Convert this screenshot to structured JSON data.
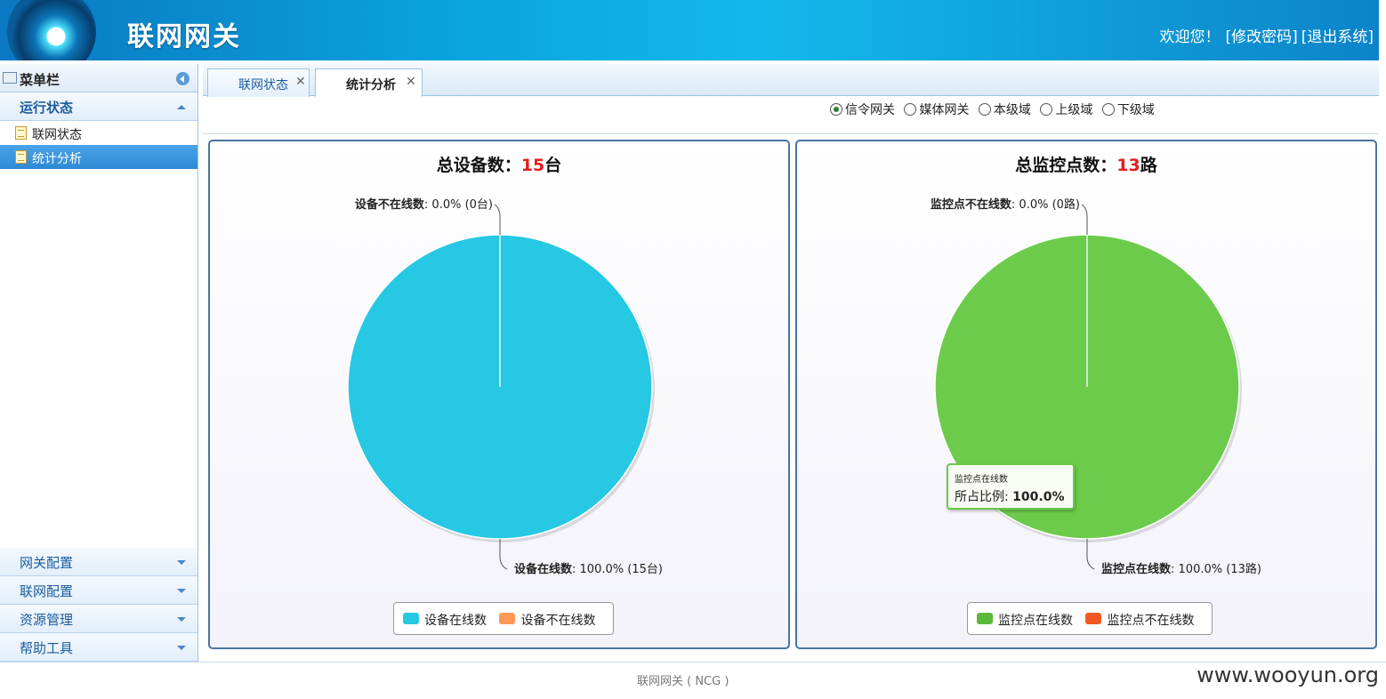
{
  "header": {
    "app_title": "联网网关",
    "welcome": "欢迎您！",
    "change_password": "[修改密码]",
    "logout": "[退出系统]"
  },
  "sidebar": {
    "title": "菜单栏",
    "active_group": "运行状态",
    "items": [
      "联网状态",
      "统计分析"
    ],
    "selected_item": "统计分析",
    "bottom_groups": [
      "网关配置",
      "联网配置",
      "资源管理",
      "帮助工具"
    ]
  },
  "tabs": [
    {
      "label": "联网状态",
      "active": false
    },
    {
      "label": "统计分析",
      "active": true
    }
  ],
  "filter": {
    "options": [
      "信令网关",
      "媒体网关",
      "本级域",
      "上级域",
      "下级域"
    ],
    "selected": "信令网关"
  },
  "panels": [
    {
      "title_prefix": "总设备数：",
      "total": "15",
      "unit": "台",
      "top_label_name": "设备不在线数",
      "top_label_value": ": 0.0% (0台)",
      "bottom_label_name": "设备在线数",
      "bottom_label_value": ": 100.0% (15台)",
      "legend": [
        "设备在线数",
        "设备不在线数"
      ]
    },
    {
      "title_prefix": "总监控点数：",
      "total": "13",
      "unit": "路",
      "top_label_name": "监控点不在线数",
      "top_label_value": ": 0.0% (0路)",
      "bottom_label_name": "监控点在线数",
      "bottom_label_value": ": 100.0% (13路)",
      "legend": [
        "监控点在线数",
        "监控点不在线数"
      ],
      "tooltip": {
        "name": "监控点在线数",
        "prefix": "所占比例:",
        "value": "100.0%"
      }
    }
  ],
  "chart_data": [
    {
      "type": "pie",
      "title": "总设备数：15台",
      "categories": [
        "设备在线数",
        "设备不在线数"
      ],
      "values": [
        15,
        0
      ],
      "percentages": [
        100.0,
        0.0
      ],
      "colors": [
        "#26c8e3",
        "#ff9955"
      ],
      "legend": "bottom-center"
    },
    {
      "type": "pie",
      "title": "总监控点数：13路",
      "categories": [
        "监控点在线数",
        "监控点不在线数"
      ],
      "values": [
        13,
        0
      ],
      "percentages": [
        100.0,
        0.0
      ],
      "colors": [
        "#6ccb4b",
        "#f05a22"
      ],
      "legend": "bottom-center"
    }
  ],
  "footer": {
    "text": "联网网关 ( NCG )",
    "watermark": "www.wooyun.org"
  }
}
